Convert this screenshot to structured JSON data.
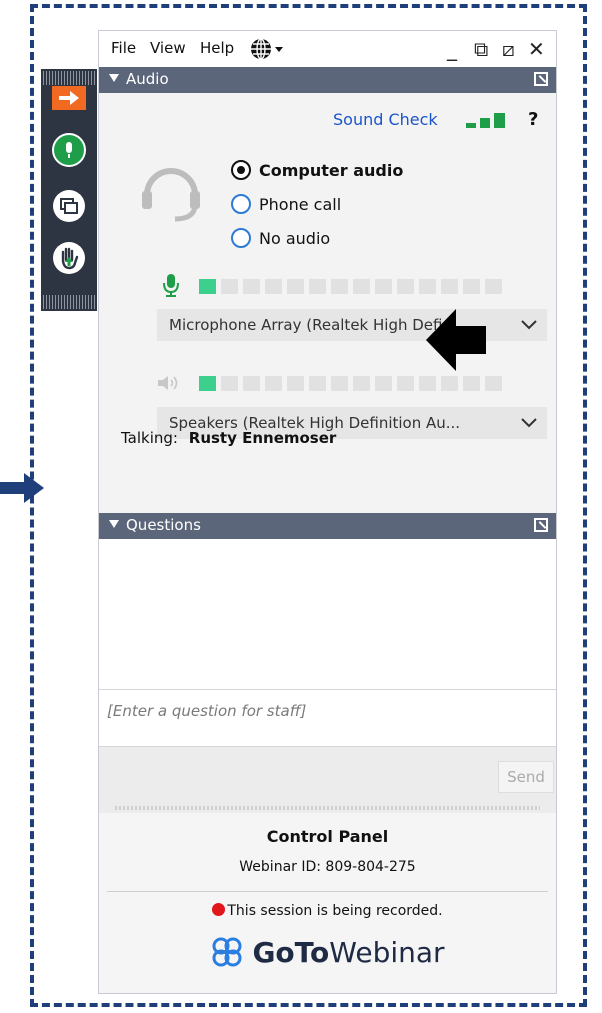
{
  "menu": {
    "file": "File",
    "view": "View",
    "help": "Help"
  },
  "window_controls": {
    "minimize": "_",
    "restore": "⧉",
    "popout": "⧄",
    "close": "✕"
  },
  "audio": {
    "title": "Audio",
    "sound_check": "Sound Check",
    "help": "?",
    "options": [
      "Computer audio",
      "Phone call",
      "No audio"
    ],
    "selected_option": "Computer audio",
    "mic_level_fraction": 0.07,
    "speaker_level_fraction": 0.07,
    "microphone": "Microphone Array (Realtek High Defi...",
    "speakers": "Speakers (Realtek High Definition Au...",
    "talking_label": "Talking:",
    "talking_name": "Rusty Ennemoser"
  },
  "questions": {
    "title": "Questions",
    "placeholder": "[Enter a question for staff]",
    "send": "Send"
  },
  "footer": {
    "title": "Control Panel",
    "webinar_id": "Webinar ID: 809-804-275",
    "recording": "This session is being recorded.",
    "brand_bold": "GoTo",
    "brand_light": "Webinar"
  },
  "colors": {
    "frame": "#1f3f7a",
    "accent_green": "#1f9e4a",
    "meter_green": "#3ccf8e",
    "link_blue": "#1a55c9",
    "section_bar": "#5b667a",
    "side_bar": "#2d3442",
    "record_red": "#e0161b",
    "share_orange": "#f26a21"
  }
}
